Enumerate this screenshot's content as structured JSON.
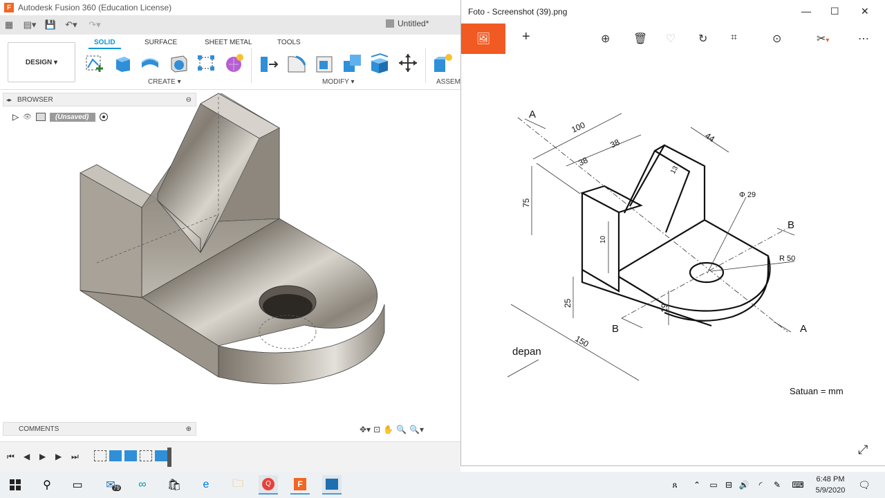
{
  "fusion": {
    "title": "Autodesk Fusion 360 (Education License)",
    "logo": "F",
    "doc_tab": "Untitled*",
    "design_button": "DESIGN ▾",
    "tabs": [
      "SOLID",
      "SURFACE",
      "SHEET METAL",
      "TOOLS"
    ],
    "groups": {
      "create": "CREATE ▾",
      "modify": "MODIFY ▾",
      "assemble": "ASSEMB"
    },
    "browser_label": "BROWSER",
    "browser_item": "(Unsaved)",
    "comments_label": "COMMENTS"
  },
  "photos": {
    "title": "Foto - Screenshot (39).png",
    "window_controls": {
      "minimize": "—",
      "maximize": "☐",
      "close": "✕"
    },
    "drawing": {
      "labels": {
        "A_top": "A",
        "A_bottom": "A",
        "B_right": "B",
        "B_left": "B",
        "dim_100": "100",
        "dim_38a": "38",
        "dim_38b": "38",
        "dim_44": "44",
        "dim_13": "13",
        "dim_75": "75",
        "dim_10": "10",
        "dim_25": "25",
        "dim_19": "19",
        "dim_150": "150",
        "phi29": "Φ 29",
        "r50": "R 50",
        "depan": "depan",
        "satuan": "Satuan = mm"
      }
    }
  },
  "taskbar": {
    "mail_badge": "79",
    "time": "6:48 PM",
    "date": "5/9/2020"
  },
  "colors": {
    "accent": "#0696d7",
    "photos_orange": "#f15a22",
    "fusion_orange": "#f26722"
  }
}
